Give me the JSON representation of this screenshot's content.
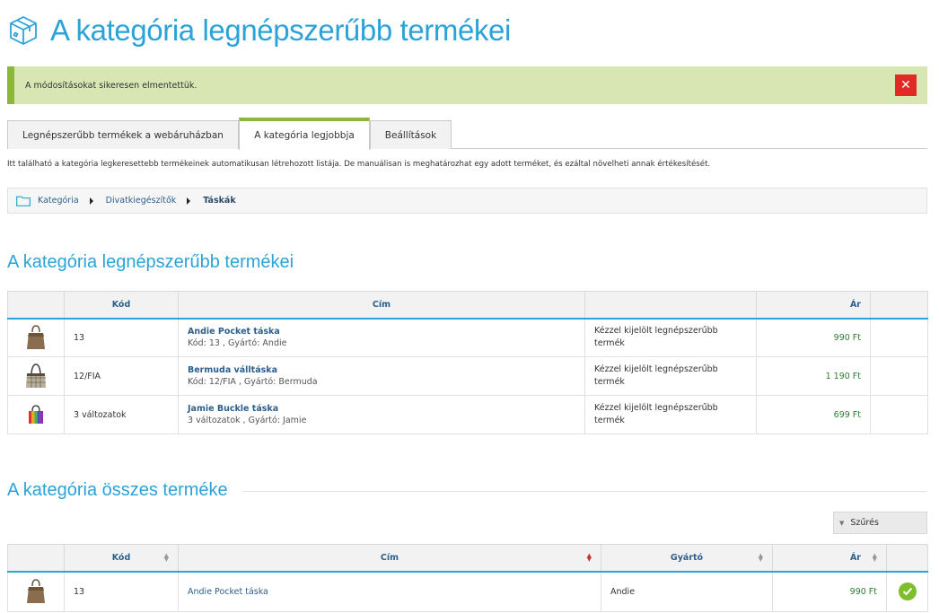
{
  "header": {
    "title": "A kategória legnépszerűbb termékei"
  },
  "alert": {
    "message": "A módosításokat sikeresen elmentettük.",
    "close_label": "✕"
  },
  "tabs": [
    {
      "label": "Legnépszerűbb termékek a webáruházban",
      "active": false
    },
    {
      "label": "A kategória legjobbja",
      "active": true
    },
    {
      "label": "Beállítások",
      "active": false
    }
  ],
  "description": "Itt található a kategória legkeresettebb termékeinek automatikusan létrehozott listája. De manuálisan is meghatározhat egy adott terméket, és ezáltal növelheti annak értékesítését.",
  "breadcrumb": [
    "Kategória",
    "Divatkiegészítők",
    "Táskák"
  ],
  "popular_section": {
    "title": "A kategória legnépszerűbb termékei",
    "columns": {
      "code": "Kód",
      "title": "Cím",
      "price": "Ár"
    },
    "rows": [
      {
        "code": "13",
        "name": "Andie Pocket táska",
        "meta": "Kód: 13 , Gyártó: Andie",
        "note": "Kézzel kijelölt legnépszerűbb termék",
        "price": "990 Ft"
      },
      {
        "code": "12/FIA",
        "name": "Bermuda válltáska",
        "meta": "Kód: 12/FIA , Gyártó: Bermuda",
        "note": "Kézzel kijelölt legnépszerűbb termék",
        "price": "1 190 Ft"
      },
      {
        "code": "3 változatok",
        "name": "Jamie Buckle táska",
        "meta": "3 változatok , Gyártó: Jamie",
        "note": "Kézzel kijelölt legnépszerűbb termék",
        "price": "699 Ft"
      }
    ]
  },
  "all_section": {
    "title": "A kategória összes terméke",
    "filter_label": "Szűrés",
    "columns": {
      "code": "Kód",
      "title": "Cím",
      "maker": "Gyártó",
      "price": "Ár"
    },
    "rows": [
      {
        "code": "13",
        "name": "Andie Pocket táska",
        "maker": "Andie",
        "price": "990 Ft"
      }
    ]
  },
  "colors": {
    "accent": "#2ba3d8",
    "success": "#8cb83a",
    "alert_bg": "#d8e6b3",
    "danger": "#e02a24",
    "price": "#2e7d32"
  }
}
